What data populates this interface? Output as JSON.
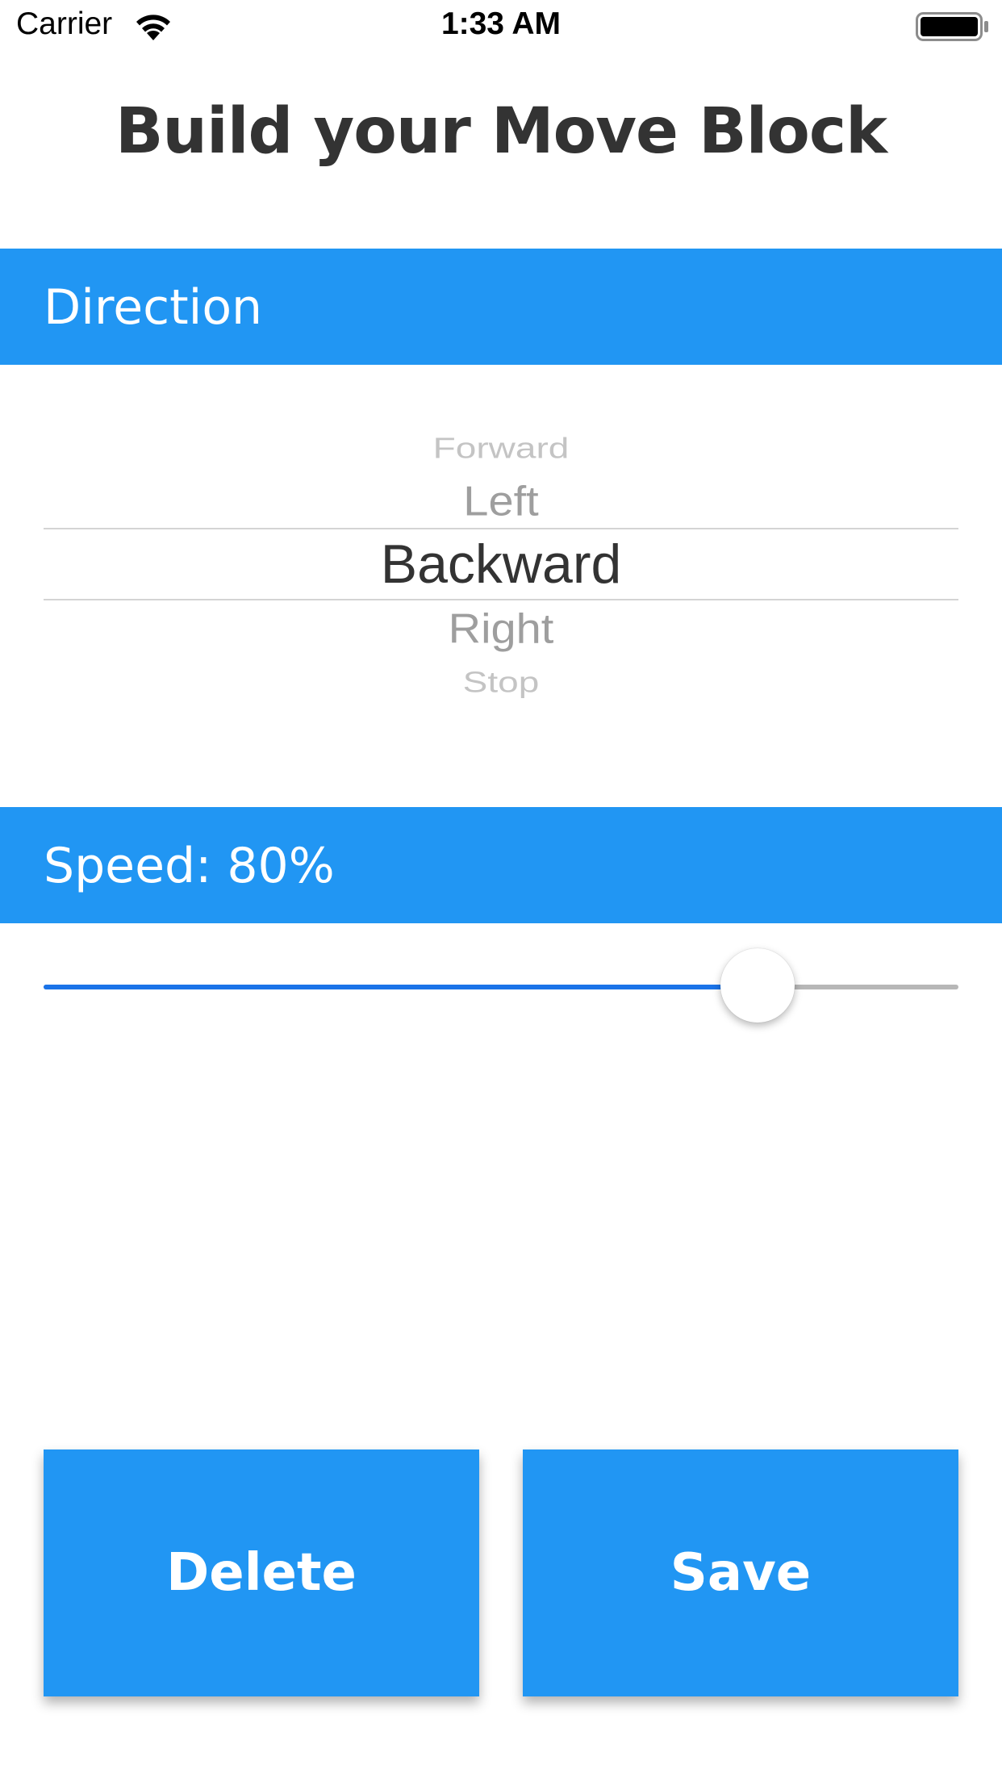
{
  "status_bar": {
    "carrier": "Carrier",
    "time": "1:33 AM",
    "wifi_icon": "wifi-icon",
    "battery_icon": "battery-icon"
  },
  "title": "Build your Move Block",
  "direction": {
    "header": "Direction",
    "options": [
      "Forward",
      "Left",
      "Backward",
      "Right",
      "Stop"
    ],
    "selected": "Backward"
  },
  "speed": {
    "header": "Speed: 80%",
    "value_fraction": 0.78
  },
  "buttons": {
    "delete_label": "Delete",
    "save_label": "Save"
  },
  "colors": {
    "accent": "#2196F3",
    "slider_fill": "#1a73e8",
    "title_text": "#333333"
  }
}
